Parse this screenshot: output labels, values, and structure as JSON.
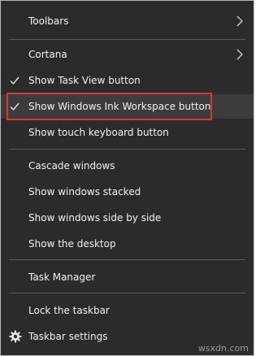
{
  "menu": {
    "items": [
      {
        "label": "Toolbars",
        "has_submenu": true
      },
      {
        "label": "Cortana",
        "has_submenu": true
      },
      {
        "label": "Show Task View button",
        "checked": true
      },
      {
        "label": "Show Windows Ink Workspace button",
        "checked": true,
        "highlighted": true
      },
      {
        "label": "Show touch keyboard button"
      },
      {
        "label": "Cascade windows"
      },
      {
        "label": "Show windows stacked"
      },
      {
        "label": "Show windows side by side"
      },
      {
        "label": "Show the desktop"
      },
      {
        "label": "Task Manager"
      },
      {
        "label": "Lock the taskbar"
      },
      {
        "label": "Taskbar settings",
        "icon": "gear-icon"
      }
    ]
  },
  "watermark": "wsxdn.com",
  "colors": {
    "menu_bg": "#2b2b2b",
    "text": "#f2f2f2",
    "highlight_bg": "#3c3c3c",
    "separator": "#5a5a5a",
    "annotation_red": "#d7392f"
  }
}
